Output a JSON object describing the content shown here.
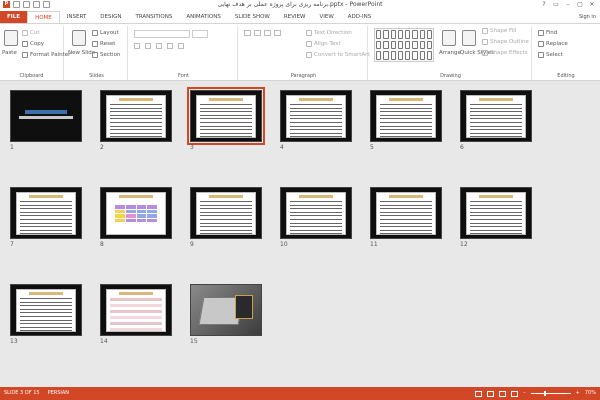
{
  "window": {
    "title": "برنامه ریزی برای پروژه عملی بر هدف نهایی.pptx - PowerPoint",
    "app_badge": "P",
    "controls": [
      "?",
      "▭",
      "–",
      "▢",
      "✕"
    ]
  },
  "tabs": [
    {
      "label": "FILE",
      "kind": "file"
    },
    {
      "label": "HOME",
      "kind": "active"
    },
    {
      "label": "INSERT",
      "kind": ""
    },
    {
      "label": "DESIGN",
      "kind": ""
    },
    {
      "label": "TRANSITIONS",
      "kind": ""
    },
    {
      "label": "ANIMATIONS",
      "kind": ""
    },
    {
      "label": "SLIDE SHOW",
      "kind": ""
    },
    {
      "label": "REVIEW",
      "kind": ""
    },
    {
      "label": "VIEW",
      "kind": ""
    },
    {
      "label": "ADD-INS",
      "kind": ""
    }
  ],
  "account": "Sign in",
  "ribbon": {
    "clipboard": {
      "label": "Clipboard",
      "paste": "Paste",
      "cut": "Cut",
      "copy": "Copy",
      "format_painter": "Format Painter"
    },
    "slides": {
      "label": "Slides",
      "new_slide": "New Slide",
      "layout": "Layout",
      "reset": "Reset",
      "section": "Section"
    },
    "font": {
      "label": "Font"
    },
    "paragraph": {
      "label": "Paragraph",
      "text_direction": "Text Direction",
      "align_text": "Align Text",
      "convert_smartart": "Convert to SmartArt"
    },
    "drawing": {
      "label": "Drawing",
      "arrange": "Arrange",
      "quick_styles": "Quick Styles",
      "shape_fill": "Shape Fill",
      "shape_outline": "Shape Outline",
      "shape_effects": "Shape Effects"
    },
    "editing": {
      "label": "Editing",
      "find": "Find",
      "replace": "Replace",
      "select": "Select"
    }
  },
  "slides": [
    {
      "num": "1",
      "style": "dark"
    },
    {
      "num": "2",
      "style": "text"
    },
    {
      "num": "3",
      "style": "text",
      "selected": true
    },
    {
      "num": "4",
      "style": "text"
    },
    {
      "num": "5",
      "style": "text"
    },
    {
      "num": "6",
      "style": "text"
    },
    {
      "num": "7",
      "style": "text"
    },
    {
      "num": "8",
      "style": "table"
    },
    {
      "num": "9",
      "style": "text"
    },
    {
      "num": "10",
      "style": "text"
    },
    {
      "num": "11",
      "style": "text"
    },
    {
      "num": "12",
      "style": "text"
    },
    {
      "num": "13",
      "style": "text"
    },
    {
      "num": "14",
      "style": "pinkrows"
    },
    {
      "num": "15",
      "style": "photo"
    }
  ],
  "status": {
    "slide_counter": "SLIDE 3 OF 15",
    "language": "PERSIAN",
    "zoom": "70%",
    "zoom_level": 0.7
  }
}
